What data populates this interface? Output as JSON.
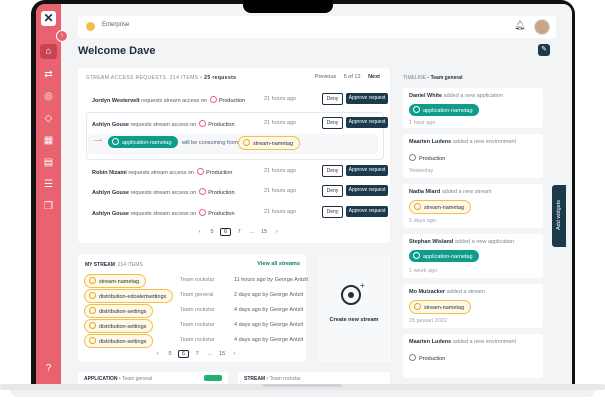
{
  "topbar": {
    "enterprise_name": "Enterprise"
  },
  "welcome": "Welcome Dave",
  "stream_access": {
    "title": "STREAM ACCESS REQUESTS",
    "items_count": "214 ITEMS",
    "requests_count": "25 requests",
    "prev_label": "Previous",
    "page_of": "5 of 12",
    "next_label": "Next",
    "requests": [
      {
        "user": "Jordyn Westervelt",
        "text": "requests stream access on",
        "env": "Production",
        "ago": "21 hours ago",
        "deny": "Deny",
        "approve": "Approve request"
      },
      {
        "user": "Ashlyn Gouse",
        "text": "requests stream access on",
        "env": "Production",
        "ago": "21 hours ago",
        "deny": "Deny",
        "approve": "Approve request"
      },
      {
        "user": "Robin Nizami",
        "text": "requests stream access on",
        "env": "Production",
        "ago": "21 hours ago",
        "deny": "Deny",
        "approve": "Approve request"
      },
      {
        "user": "Ashlyn Gouse",
        "text": "requests stream access on",
        "env": "Production",
        "ago": "21 hours ago",
        "deny": "Deny",
        "approve": "Approve request"
      },
      {
        "user": "Ashlyn Gouse",
        "text": "requests stream access on",
        "env": "Production",
        "ago": "21 hours ago",
        "deny": "Deny",
        "approve": "Approve request"
      }
    ],
    "consuming": {
      "app": "application-nametag",
      "text": "will be consuming from",
      "stream": "stream-nametag"
    },
    "pager": [
      "5",
      "6",
      "7",
      "...",
      "15"
    ],
    "pager_current": "6"
  },
  "my_stream": {
    "title": "MY STREAM",
    "items_count": "214 ITEMS",
    "view_all": "View all streams",
    "rows": [
      {
        "name": "stream-nametag",
        "team": "Team rockstar",
        "ago": "11 hours ago by George Antzit"
      },
      {
        "name": "distribution-edoalertsettings",
        "team": "Team general",
        "ago": "2 days ago by George Antzit"
      },
      {
        "name": "distribution-settings",
        "team": "Team rockstar",
        "ago": "4 days ago by George Antzit"
      },
      {
        "name": "distribution-settings",
        "team": "Team rockstar",
        "ago": "4 days ago by George Antzit"
      },
      {
        "name": "distribution-settings",
        "team": "Team rockstar",
        "ago": "4 days ago by George Antzit"
      }
    ],
    "pager": [
      "5",
      "6",
      "7",
      "...",
      "15"
    ],
    "pager_current": "6"
  },
  "create_stream": {
    "label": "Create new stream"
  },
  "bottom": {
    "application": "APPLICATION",
    "application_team": "Team general",
    "stream": "STREAM",
    "stream_team": "Team rockstar"
  },
  "timeline": {
    "title": "TIMELINE",
    "team": "Team general",
    "items": [
      {
        "who": "Daniel White",
        "action": "added a new application",
        "pill": "application-nametag",
        "pill_type": "app",
        "when": "1 hour ago"
      },
      {
        "who": "Maarten Ludens",
        "action": "added a new environment",
        "pill": "Production",
        "pill_type": "env",
        "when": "Yesterday"
      },
      {
        "who": "Nadia Miard",
        "action": "added a new stream",
        "pill": "stream-nametag",
        "pill_type": "stream",
        "when": "5 days ago"
      },
      {
        "who": "Stephan Wisland",
        "action": "added a new application",
        "pill": "application-nametag",
        "pill_type": "app",
        "when": "1 week ago"
      },
      {
        "who": "Mo Mulzacker",
        "action": "added a stream",
        "pill": "stream-nametag",
        "pill_type": "stream",
        "when": "15 januari 2022"
      },
      {
        "who": "Maarten Ludens",
        "action": "added a new environment",
        "pill": "Production",
        "pill_type": "env",
        "when": ""
      }
    ]
  },
  "add_widgets": "Add widgets",
  "colors": {
    "rail": "#e8636f",
    "accent": "#1b3a4b",
    "app_pill": "#0f9d8a",
    "stream_pill_border": "#f0c04a"
  }
}
